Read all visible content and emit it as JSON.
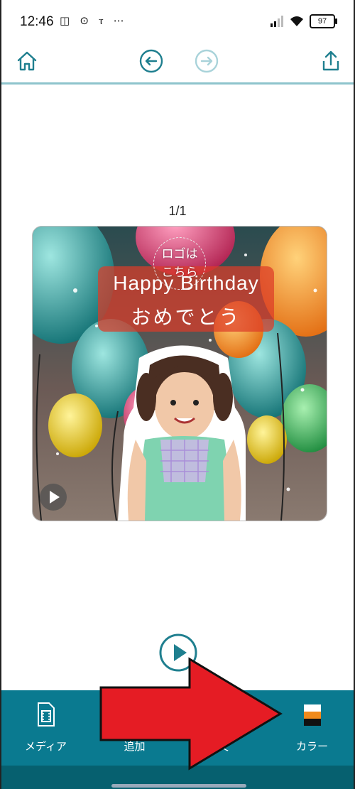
{
  "status": {
    "time": "12:46",
    "left_icons": "◫ ⊙ ⲧ ⋯",
    "battery": "97"
  },
  "toolbar": {
    "home_icon": "home-icon",
    "undo_icon": "undo-icon",
    "redo_icon": "redo-icon",
    "share_icon": "share-icon"
  },
  "page_indicator": "1/1",
  "preview": {
    "logo_line1": "ロゴは",
    "logo_line2": "こちら",
    "banner_line1": "Happy Birthday",
    "banner_line2": "おめでとう"
  },
  "bottom_nav": [
    {
      "label": "メディア",
      "icon": "media-film-icon"
    },
    {
      "label": "追加",
      "icon": "add-icon"
    },
    {
      "label": "文",
      "icon": "text-icon"
    },
    {
      "label": "カラー",
      "icon": "color-swatch-icon"
    }
  ],
  "colors": {
    "accent": "#1f7f8f",
    "bottom_bar": "#0a7a90",
    "arrow": "#e51c24"
  }
}
